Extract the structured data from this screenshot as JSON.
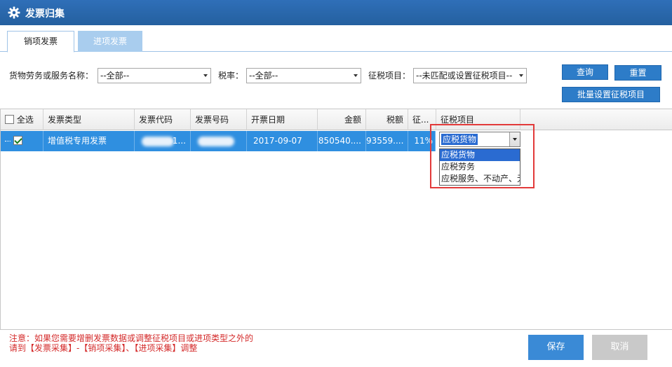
{
  "window": {
    "title": "发票归集",
    "icon": "gear-icon"
  },
  "tabs": [
    {
      "label": "销项发票",
      "active": true
    },
    {
      "label": "进项发票",
      "active": false
    }
  ],
  "filters": {
    "goods_label": "货物劳务或服务名称：",
    "goods_value": "--全部--",
    "rate_label": "税率：",
    "rate_value": "--全部--",
    "tax_item_label": "征税项目：",
    "tax_item_value": "--未匹配或设置征税项目--"
  },
  "buttons": {
    "query": "查询",
    "reset": "重置",
    "batch_set": "批量设置征税项目",
    "save": "保存",
    "cancel": "取消"
  },
  "table": {
    "select_all": "全选",
    "columns": [
      "发票类型",
      "发票代码",
      "发票号码",
      "开票日期",
      "金额",
      "税额",
      "征...",
      "征税项目"
    ],
    "rows": [
      {
        "checked": true,
        "type": "增值税专用发票",
        "code_suffix": "1...",
        "number": "",
        "date": "2017-09-07",
        "amount": "850540....",
        "tax": "93559....",
        "rate": "11%",
        "tax_item": "应税货物"
      }
    ]
  },
  "tax_item_dropdown": {
    "selected": "应税货物",
    "options": [
      "应税货物",
      "应税劳务",
      "应税服务、不动产、无形资产"
    ]
  },
  "notice": {
    "line1": "注意：如果您需要增删发票数据或调整征税项目或进项类型之外的",
    "line2": "请到【发票采集】-【销项采集】、【进项采集】调整"
  },
  "colors": {
    "title_bar": "#2f6fb8",
    "selected_row": "#2f8fe0",
    "button": "#2d7cc8",
    "button_disabled": "#c9c9c9",
    "highlight_box": "#e23a3a",
    "notice_text": "#d42a2a"
  }
}
